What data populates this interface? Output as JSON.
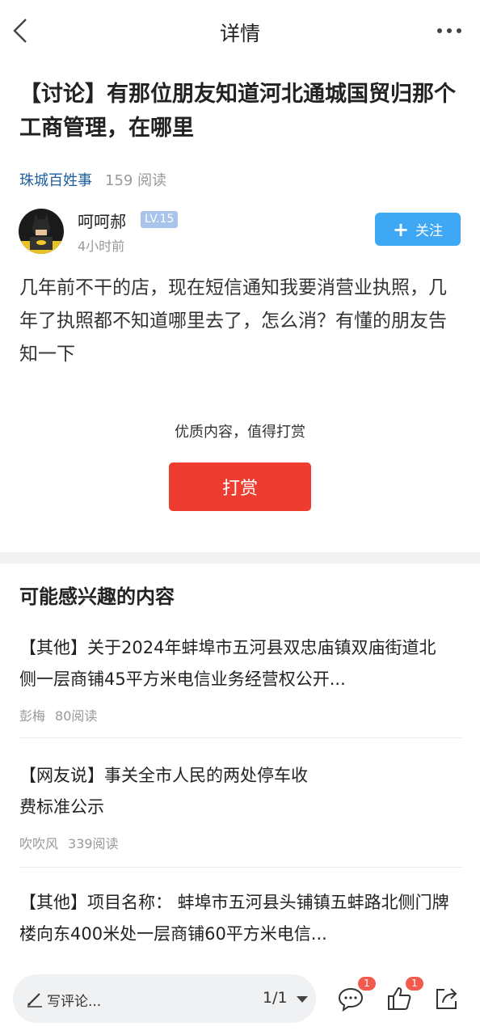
{
  "nav": {
    "title": "详情",
    "back_icon": "chevron-left-icon",
    "more_icon": "more-dots-icon"
  },
  "post": {
    "title": "【讨论】有那位朋友知道河北通城国贸归那个工商管理，在哪里",
    "forum": "珠城百姓事",
    "reads": "159 阅读",
    "author": "呵呵郝",
    "level": "LV.15",
    "time": "4小时前",
    "follow_label": "关注",
    "content": "几年前不干的店，现在短信通知我要消营业执照，几年了执照都不知道哪里去了，怎么消？有懂的朋友告知一下"
  },
  "reward": {
    "prompt": "优质内容，值得打赏",
    "button_label": "打赏"
  },
  "recommend": {
    "section_title": "可能感兴趣的内容",
    "items": [
      {
        "title": "【其他】关于2024年蚌埠市五河县双忠庙镇双庙街道北侧一层商铺45平方米电信业务经营权公开...",
        "author": "彭梅",
        "reads": "80阅读"
      },
      {
        "title": "【网友说】事关全市人民的两处停车收费标准公示",
        "author": "吹吹风",
        "reads": "339阅读"
      },
      {
        "title": "【其他】项目名称： 蚌埠市五河县头铺镇五蚌路北侧门牌楼向东400米处一层商铺60平方米电信...",
        "author": "",
        "reads": ""
      }
    ]
  },
  "bottom_bar": {
    "comment_placeholder": "写评论...",
    "pager": "1/1",
    "comment_badge": "1",
    "like_badge": "1",
    "icons": [
      "pencil-icon",
      "comment-bubble-icon",
      "thumbs-up-icon",
      "share-icon"
    ]
  },
  "colors": {
    "forum_link": "#1d5f9c",
    "follow_button": "#3ea8f4",
    "reward_button": "#ee3c31",
    "badge": "#f25a4d"
  }
}
